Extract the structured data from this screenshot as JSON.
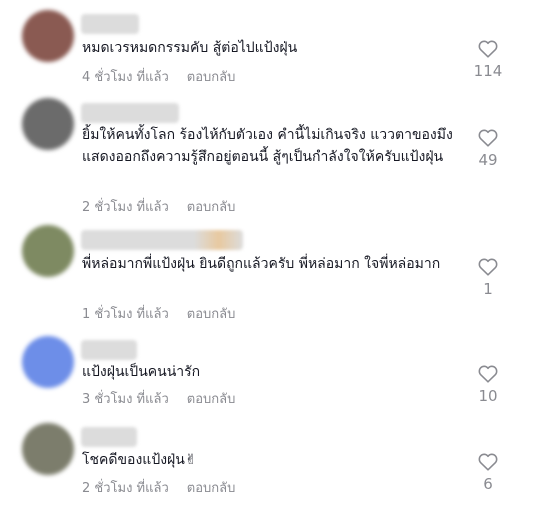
{
  "comments": [
    {
      "text": "หมดเวรหมดกรรมคับ สู้ต่อไปแป้งฝุ่น",
      "time": "4 ชั่วโมง ที่แล้ว",
      "reply": "ตอบกลับ",
      "likes": "114",
      "avatar_color": "#8a5a52"
    },
    {
      "text": "ยิ้มให้คนทั้งโลก ร้องไห้กับตัวเอง คำนี้ไม่เกินจริง แววตาของมึงแสดงออกถึงความรู้สึกอยู่ตอนนี้ สู้ๆเป็นกำลังใจให้ครับแป้งฝุ่น",
      "time": "2 ชั่วโมง ที่แล้ว",
      "reply": "ตอบกลับ",
      "likes": "49",
      "avatar_color": "#6b6b6b"
    },
    {
      "text": "พี่หล่อมากพี่แป้งฝุ่น ยินดีถูกแล้วครับ พี่หล่อมาก ใจพี่หล่อมาก",
      "time": "1 ชั่วโมง ที่แล้ว",
      "reply": "ตอบกลับ",
      "likes": "1",
      "avatar_color": "#7e8a62"
    },
    {
      "text": "แป้งฝุ่นเป็นคนน่ารัก",
      "time": "3 ชั่วโมง ที่แล้ว",
      "reply": "ตอบกลับ",
      "likes": "10",
      "avatar_color": "#6d8ee8"
    },
    {
      "text": "โชคดีของแป้งฝุ่น✌",
      "time": "2 ชั่วโมง ที่แล้ว",
      "reply": "ตอบกลับ",
      "likes": "6",
      "avatar_color": "#7c7d6c"
    }
  ]
}
